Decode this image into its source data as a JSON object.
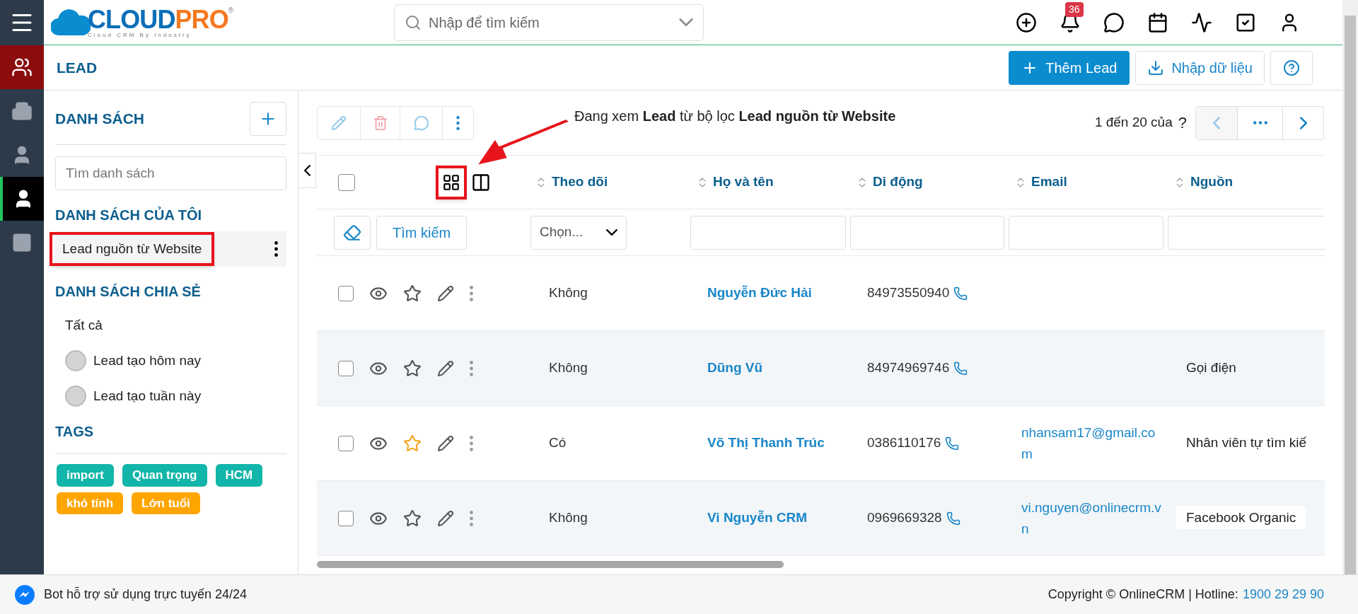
{
  "logo": {
    "word_1": "CLOUD",
    "word_2": "PRO",
    "mark": "®",
    "tagline": "Cloud CRM By Industry"
  },
  "search": {
    "placeholder": "Nhập để tìm kiếm"
  },
  "notifications": {
    "badge": "36"
  },
  "rail": [
    {
      "kind": "module",
      "selected": false
    },
    {
      "kind": "nav",
      "selected": false
    },
    {
      "kind": "nav",
      "selected": false
    },
    {
      "kind": "nav",
      "selected": true
    },
    {
      "kind": "nav",
      "selected": false
    }
  ],
  "page": {
    "title": "LEAD",
    "buttons": [
      {
        "kind": "primary",
        "label": "Thêm Lead"
      },
      {
        "kind": "import",
        "label": "Nhập dữ liệu"
      },
      {
        "kind": "help"
      }
    ]
  },
  "lists": {
    "title": "DANH SÁCH",
    "search_placeholder": "Tìm danh sách",
    "sections": [
      {
        "title": "DANH SÁCH CỦA TÔI",
        "items": [
          {
            "label": "Lead nguồn từ Website",
            "selected": true,
            "avatar": false,
            "highlighted": true
          }
        ]
      },
      {
        "title": "DANH SÁCH CHIA SẺ",
        "items": [
          {
            "label": "Tất cả",
            "selected": false,
            "avatar": false
          },
          {
            "label": "Lead tạo hôm nay",
            "selected": false,
            "avatar": true
          },
          {
            "label": "Lead tạo tuần này",
            "selected": false,
            "avatar": true
          }
        ]
      }
    ],
    "tags_title": "TAGS",
    "tags": [
      {
        "label": "import",
        "color": "#12b5a9"
      },
      {
        "label": "Quan trọng",
        "color": "#12b5a9"
      },
      {
        "label": "HCM",
        "color": "#12b5a9"
      },
      {
        "label": "khó tính",
        "color": "#ffa500"
      },
      {
        "label": "Lớn tuổi",
        "color": "#ffa500"
      }
    ]
  },
  "table": {
    "filter_text": "Đang xem **Lead** từ bộ lọc **Lead nguồn từ Website**",
    "pagination": "1 đến 20 của",
    "total": "?",
    "columns": [
      "Theo dõi",
      "Họ và tên",
      "Di động",
      "Email",
      "Nguồn"
    ],
    "select_all": false,
    "filter_select": "Chọn...",
    "search_button": "Tìm kiếm",
    "rows": [
      {
        "checked": false,
        "starred": false,
        "follow": "Không",
        "name": "Nguyễn Đức Hải",
        "phone": "84973550940",
        "email": "",
        "source": ""
      },
      {
        "checked": false,
        "starred": false,
        "follow": "Không",
        "name": "Dũng Vũ",
        "phone": "84974969746",
        "email": "",
        "source": "Gọi điện"
      },
      {
        "checked": false,
        "starred": true,
        "follow": "Có",
        "name": "Võ Thị Thanh Trúc",
        "phone": "0386110176",
        "email": "nhansam17@gmail.com",
        "source": "Nhân viên tự tìm kiế"
      },
      {
        "checked": false,
        "starred": false,
        "follow": "Không",
        "name": "Vi Nguyễn CRM",
        "phone": "0969669328",
        "email": "vi.nguyen@onlinecrm.vn",
        "source": "Facebook Organic"
      }
    ]
  },
  "footer": {
    "bot": "Bot hỗ trợ sử dụng trực tuyến 24/24",
    "copyright": "Copyright © OnlineCRM | Hotline:",
    "hotline": "1900 29 29 90"
  }
}
